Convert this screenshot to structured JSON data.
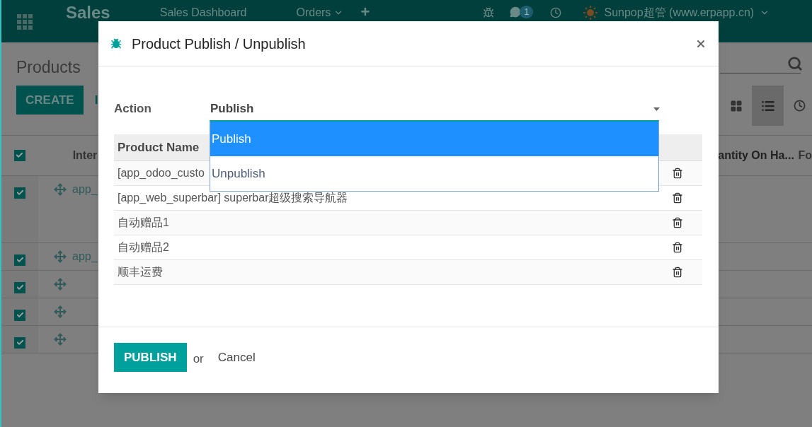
{
  "navbar": {
    "app_name": "Sales",
    "menus": [
      {
        "label": "Sales Dashboard",
        "has_dropdown": false
      },
      {
        "label": "Orders",
        "has_dropdown": true
      }
    ],
    "quick_create": "+",
    "chat_count": "1",
    "user": "Sunpop超管 (www.erpapp.cn)"
  },
  "control_panel": {
    "breadcrumb": "Products",
    "buttons": [
      {
        "label": "CREATE",
        "kind": "primary"
      },
      {
        "label": "I",
        "kind": "link"
      }
    ],
    "views": [
      {
        "kind": "kanban",
        "selected": false
      },
      {
        "kind": "list",
        "selected": true
      },
      {
        "kind": "activity",
        "selected": false
      }
    ]
  },
  "list": {
    "select_all": true,
    "columns": [
      "Inter",
      "antity On Ha...",
      "Fo"
    ],
    "rows": [
      {
        "checked": true,
        "name": "app_",
        "tall": true
      },
      {
        "checked": true,
        "name": "app_",
        "tall": false
      },
      {
        "checked": true,
        "tall": false
      },
      {
        "checked": true,
        "tall": false
      },
      {
        "checked": true,
        "tall": false
      }
    ]
  },
  "dialog": {
    "title": "Product Publish / Unpublish",
    "action_label": "Action",
    "action_value": "Publish",
    "options": [
      {
        "label": "Publish",
        "selected": true
      },
      {
        "label": "Unpublish",
        "selected": false
      }
    ],
    "column": "Product Name",
    "rows": [
      "[app_odoo_custo",
      "[app_web_superbar] superbar超级搜索导航器",
      "自动赠品1",
      "自动赠品2",
      "顺丰运费"
    ],
    "primary_button": "PUBLISH",
    "or": "or",
    "cancel": "Cancel"
  }
}
